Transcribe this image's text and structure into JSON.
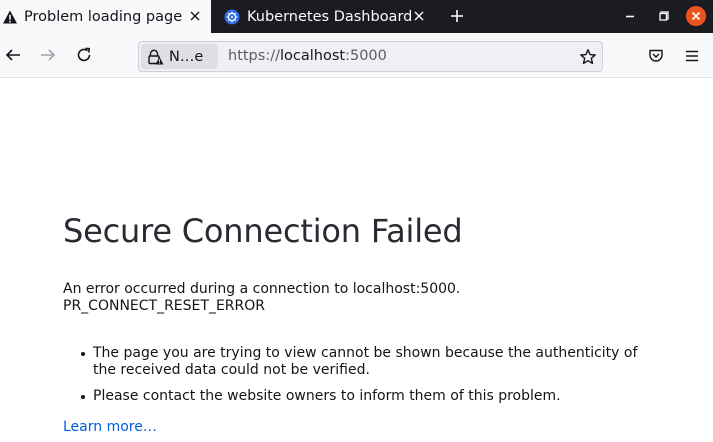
{
  "tabs": [
    {
      "label": "Problem loading page",
      "icon": "warning-icon",
      "active": true
    },
    {
      "label": "Kubernetes Dashboard",
      "icon": "kubernetes-icon",
      "active": false
    }
  ],
  "toolbar": {
    "identity_label": "N…e",
    "url_scheme": "https://",
    "url_host": "localhost",
    "url_port": ":5000"
  },
  "error": {
    "title": "Secure Connection Failed",
    "message": "An error occurred during a connection to localhost:5000.",
    "code": "PR_CONNECT_RESET_ERROR",
    "bullets": [
      "The page you are trying to view cannot be shown because the authenticity of the received data could not be verified.",
      "Please contact the website owners to inform them of this problem."
    ],
    "learn_more": "Learn more…"
  },
  "colors": {
    "tabstrip_bg": "#1c1b22",
    "active_tab_bg": "#f9f9fb",
    "close_window": "#e95420",
    "link": "#0060df"
  }
}
